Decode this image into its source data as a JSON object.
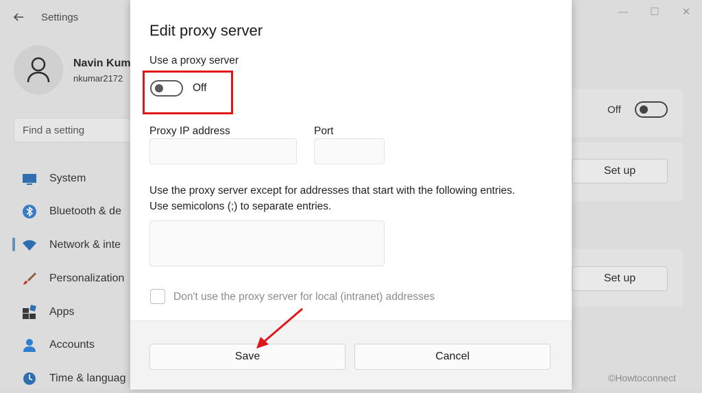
{
  "app": {
    "title": "Settings",
    "back_icon": "back-arrow-icon",
    "window_controls": [
      "minimize-icon",
      "maximize-icon",
      "close-icon"
    ]
  },
  "user": {
    "name": "Navin Kum",
    "email": "nkumar2172"
  },
  "search": {
    "placeholder": "Find a setting"
  },
  "sidebar": {
    "items": [
      {
        "label": "System",
        "icon": "monitor-icon"
      },
      {
        "label": "Bluetooth & de",
        "icon": "bluetooth-icon"
      },
      {
        "label": "Network & inte",
        "icon": "wifi-icon",
        "active": true
      },
      {
        "label": "Personalization",
        "icon": "brush-icon"
      },
      {
        "label": "Apps",
        "icon": "apps-icon"
      },
      {
        "label": "Accounts",
        "icon": "account-icon"
      },
      {
        "label": "Time & languag",
        "icon": "clock-globe-icon"
      }
    ]
  },
  "right_panel": {
    "auto_detect_state": "Off",
    "setup_button_1": "Set up",
    "setup_button_2": "Set up"
  },
  "dialog": {
    "title": "Edit proxy server",
    "use_proxy_label": "Use a proxy server",
    "toggle_state": "Off",
    "proxy_ip_label": "Proxy IP address",
    "proxy_ip_value": "",
    "port_label": "Port",
    "port_value": "",
    "exceptions_line1": "Use the proxy server except for addresses that start with the following entries.",
    "exceptions_line2": "Use semicolons (;) to separate entries.",
    "exceptions_value": "",
    "local_checkbox_label": "Don't use the proxy server for local (intranet) addresses",
    "save_label": "Save",
    "cancel_label": "Cancel"
  },
  "watermark": "©Howtoconnect",
  "colors": {
    "highlight": "#e0161b",
    "arrow": "#e0161b"
  }
}
